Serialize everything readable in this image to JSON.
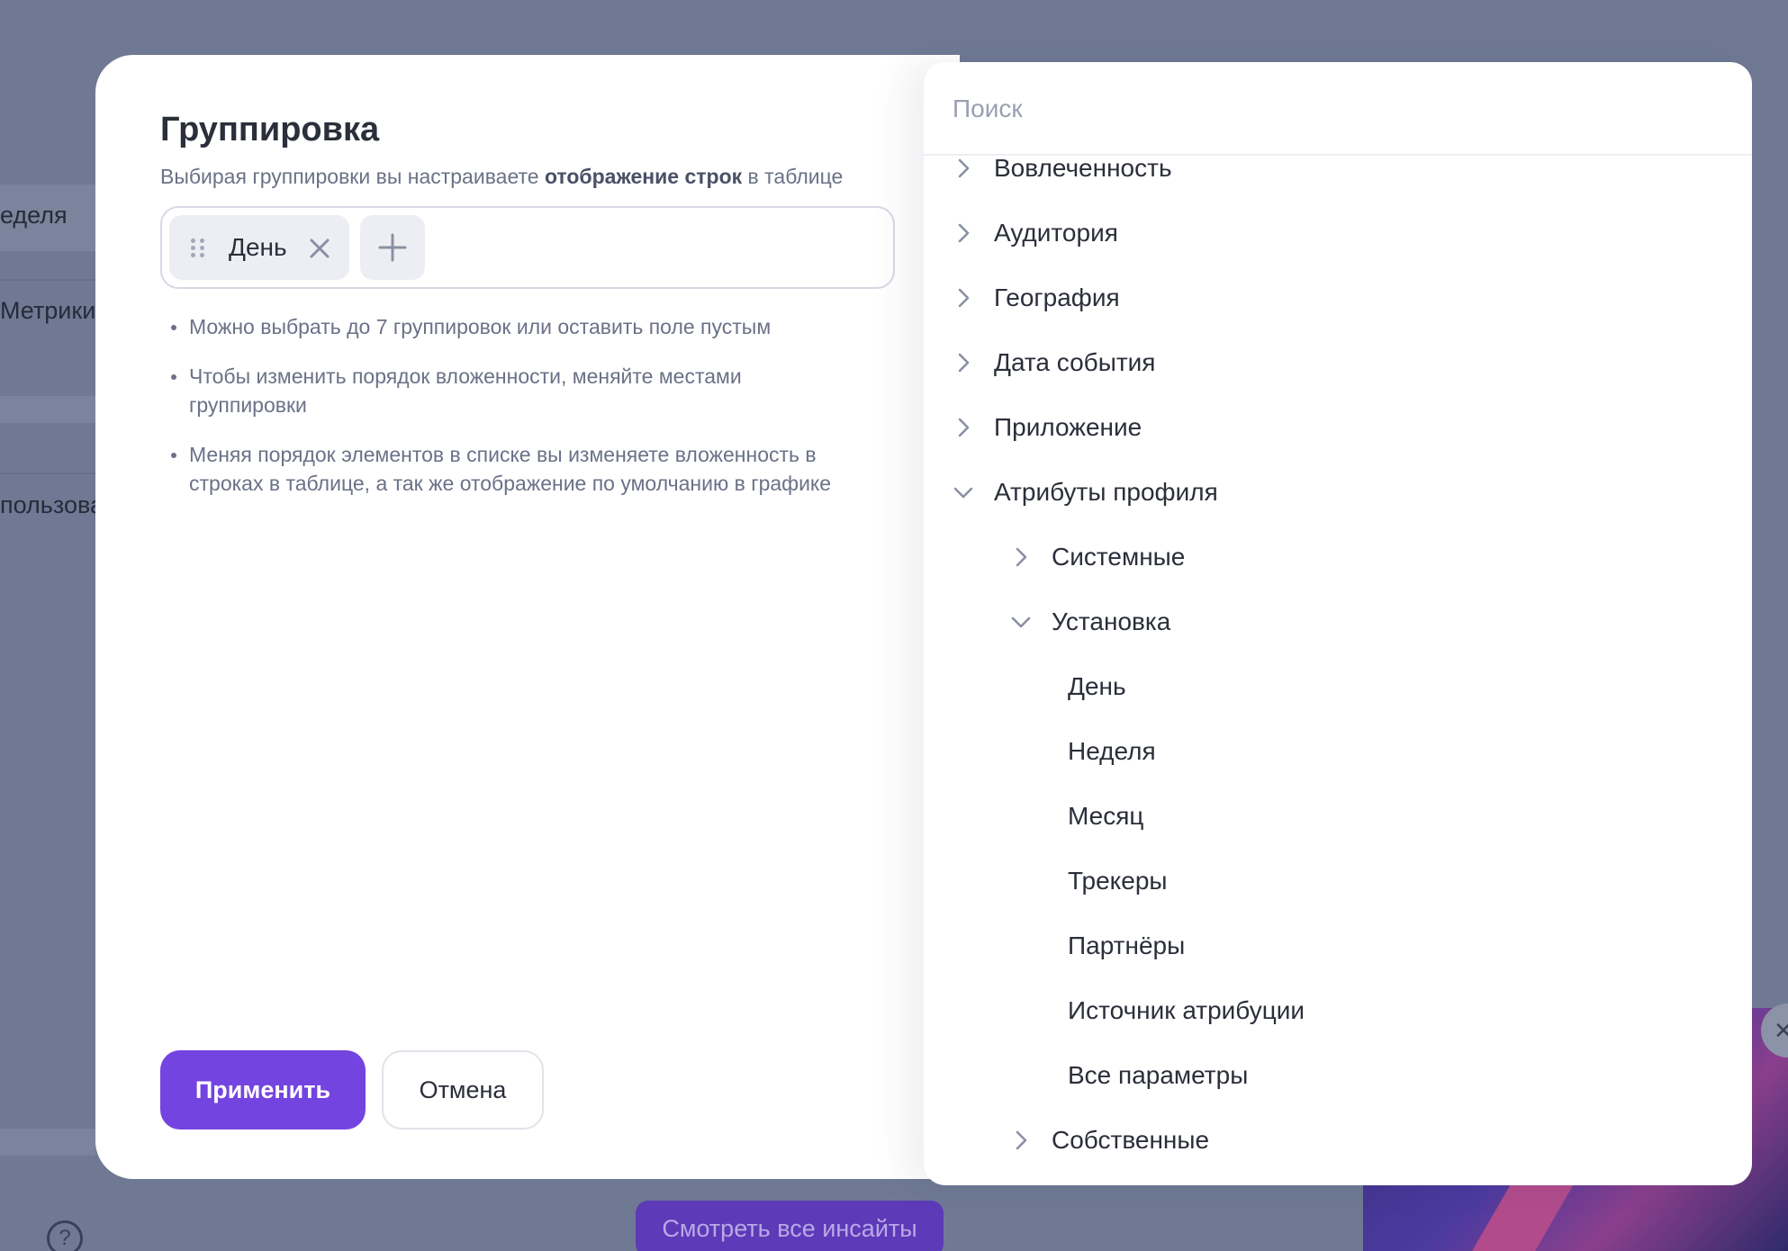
{
  "background": {
    "items": [
      "еделя",
      "Метрики",
      "пользова"
    ],
    "insights_button": "Смотреть все инсайты",
    "help_glyph": "?",
    "close_glyph": "✕"
  },
  "modal": {
    "title": "Группировка",
    "subtitle_before": "Выбирая группировки вы настраиваете ",
    "subtitle_bold": "отображение строк",
    "subtitle_after": " в таблице",
    "chips": [
      {
        "label": "День"
      }
    ],
    "hints": [
      "Можно выбрать до 7 группировок или оставить поле пустым",
      "Чтобы изменить порядок вложенности, меняйте местами группировки",
      "Меняя порядок элементов в списке вы изменяете вложенность в строках в таблице, а так же отображение по умолчанию в графике"
    ],
    "apply_label": "Применить",
    "cancel_label": "Отмена"
  },
  "popup": {
    "search_placeholder": "Поиск",
    "tree": [
      {
        "label": "Вовлеченность",
        "level": 0,
        "state": "collapsed"
      },
      {
        "label": "Аудитория",
        "level": 0,
        "state": "collapsed"
      },
      {
        "label": "География",
        "level": 0,
        "state": "collapsed"
      },
      {
        "label": "Дата события",
        "level": 0,
        "state": "collapsed"
      },
      {
        "label": "Приложение",
        "level": 0,
        "state": "collapsed"
      },
      {
        "label": "Атрибуты профиля",
        "level": 0,
        "state": "expanded"
      },
      {
        "label": "Системные",
        "level": 1,
        "state": "collapsed"
      },
      {
        "label": "Установка",
        "level": 1,
        "state": "expanded"
      },
      {
        "label": "День",
        "level": 2,
        "state": "leaf"
      },
      {
        "label": "Неделя",
        "level": 2,
        "state": "leaf"
      },
      {
        "label": "Месяц",
        "level": 2,
        "state": "leaf"
      },
      {
        "label": "Трекеры",
        "level": 2,
        "state": "leaf"
      },
      {
        "label": "Партнёры",
        "level": 2,
        "state": "leaf"
      },
      {
        "label": "Источник атрибуции",
        "level": 2,
        "state": "leaf"
      },
      {
        "label": "Все параметры",
        "level": 2,
        "state": "leaf"
      },
      {
        "label": "Собственные",
        "level": 1,
        "state": "collapsed"
      }
    ]
  },
  "colors": {
    "accent": "#7444e0",
    "overlay": "#6f7994",
    "chevron": "#8a90a3"
  }
}
